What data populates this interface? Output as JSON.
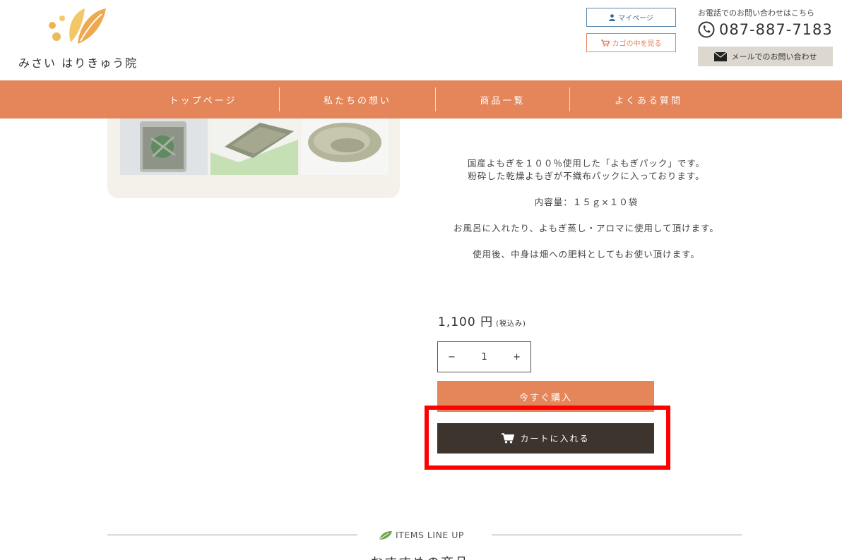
{
  "header": {
    "logo_text": "みさい はりきゅう院",
    "mypage_label": "マイページ",
    "cart_view_label": "カゴの中を見る",
    "contact_label": "お電話でのお問い合わせはこちら",
    "phone": "087-887-7183",
    "mail_label": "メールでのお問い合わせ"
  },
  "nav": {
    "items": [
      {
        "label": "トップページ"
      },
      {
        "label": "私たちの想い"
      },
      {
        "label": "商品一覧"
      },
      {
        "label": "よくある質問"
      }
    ]
  },
  "product": {
    "description": [
      "国産よもぎを１００％使用した「よもぎパック」です。",
      "粉砕した乾燥よもぎが不織布パックに入っております。",
      "内容量：１５ｇ×１０袋",
      "お風呂に入れたり、よもぎ蒸し・アロマに使用して頂けます。",
      "使用後、中身は畑への肥料としてもお使い頂けます。"
    ],
    "price": "1,100 円",
    "tax_note": "(税込み)",
    "quantity": "1",
    "qty_minus": "−",
    "qty_plus": "+",
    "buy_now_label": "今すぐ購入",
    "add_to_cart_label": "カートに入れる"
  },
  "lineup": {
    "label": "ITEMS LINE UP",
    "title": "おすすめの商品"
  },
  "colors": {
    "accent": "#e4855a",
    "dark_button": "#3d342d",
    "highlight": "#ff0000"
  }
}
